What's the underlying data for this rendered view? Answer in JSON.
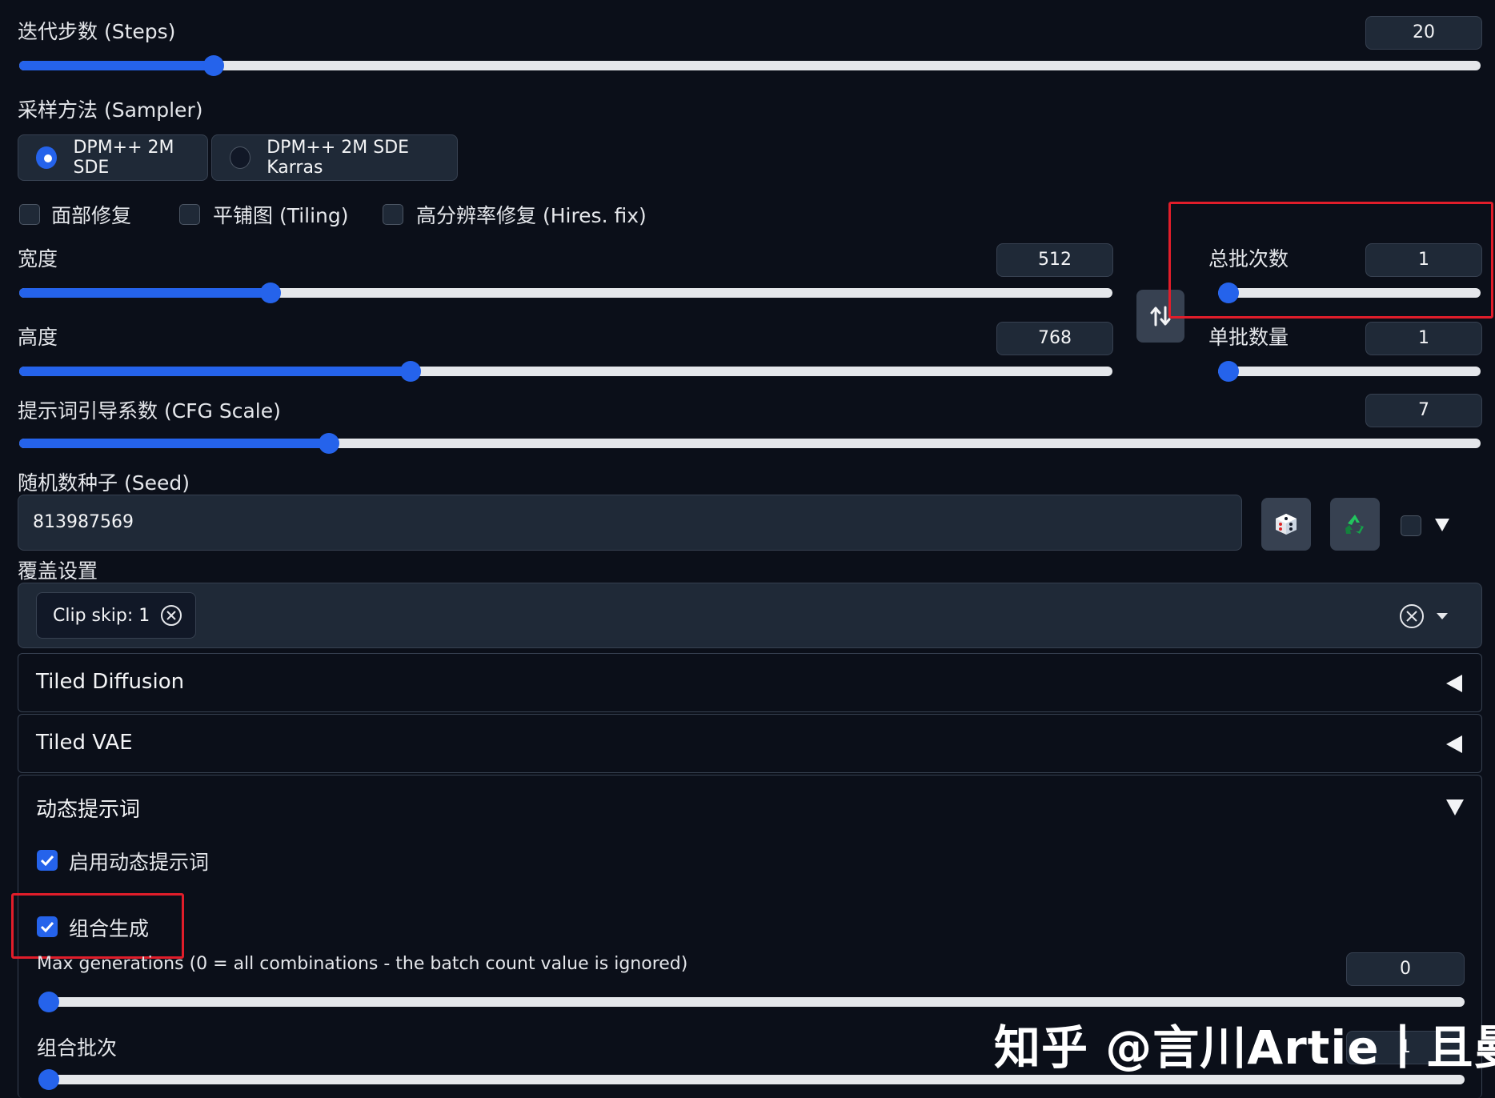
{
  "steps": {
    "label": "迭代步数 (Steps)",
    "value": "20",
    "fraction": 0.133
  },
  "sampler": {
    "label": "采样方法 (Sampler)",
    "options": [
      {
        "label": "DPM++ 2M SDE",
        "selected": true
      },
      {
        "label": "DPM++ 2M SDE Karras",
        "selected": false
      }
    ]
  },
  "options_row": {
    "face_restore": {
      "label": "面部修复",
      "checked": false
    },
    "tiling": {
      "label": "平铺图 (Tiling)",
      "checked": false
    },
    "hires_fix": {
      "label": "高分辨率修复 (Hires. fix)",
      "checked": false
    }
  },
  "width": {
    "label": "宽度",
    "value": "512",
    "fraction": 0.23
  },
  "height": {
    "label": "高度",
    "value": "768",
    "fraction": 0.358
  },
  "swap_icon": "swap-vertical-arrows-icon",
  "batch_count": {
    "label": "总批次数",
    "value": "1",
    "fraction": 0.0
  },
  "batch_size": {
    "label": "单批数量",
    "value": "1",
    "fraction": 0.0
  },
  "cfg_scale": {
    "label": "提示词引导系数 (CFG Scale)",
    "value": "7",
    "fraction": 0.212
  },
  "seed": {
    "label": "随机数种子 (Seed)",
    "value": "813987569",
    "dice_icon": "dice-icon",
    "recycle_icon": "recycle-icon",
    "extra_checked": false
  },
  "override": {
    "label": "覆盖设置",
    "chips": [
      {
        "label": "Clip skip: 1"
      }
    ]
  },
  "accordions": {
    "tiled_diffusion": {
      "label": "Tiled Diffusion",
      "open": false
    },
    "tiled_vae": {
      "label": "Tiled VAE",
      "open": false
    },
    "dynamic_prompts": {
      "label": "动态提示词",
      "open": true
    }
  },
  "dynamic": {
    "enable": {
      "label": "启用动态提示词",
      "checked": true
    },
    "combinatorial": {
      "label": "组合生成",
      "checked": true
    },
    "max_generations": {
      "label": "Max generations (0 = all combinations - the batch count value is ignored)",
      "value": "0",
      "fraction": 0.0
    },
    "combinatorial_batches": {
      "label": "组合批次",
      "value": "1",
      "fraction": 0.0
    }
  },
  "watermark": "知乎 @言川Artie丨且曼",
  "colors": {
    "accent": "#2563eb",
    "background": "#0b0f19",
    "highlight": "#e11d2a"
  }
}
